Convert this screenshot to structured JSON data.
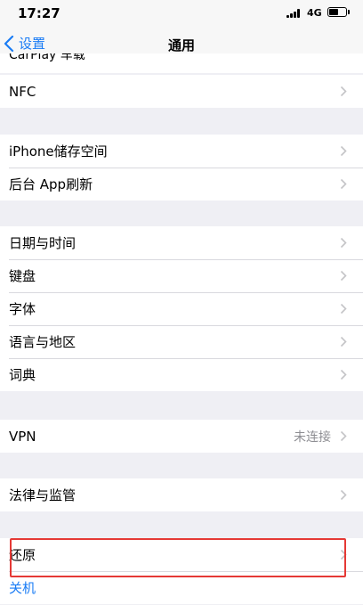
{
  "status_bar": {
    "time": "17:27",
    "network": "4G"
  },
  "nav": {
    "back_label": "设置",
    "title": "通用"
  },
  "partial_row": {
    "label": "CarPlay 车载"
  },
  "groups": [
    [
      {
        "label": "NFC"
      }
    ],
    [
      {
        "label": "iPhone储存空间"
      },
      {
        "label": "后台 App刷新"
      }
    ],
    [
      {
        "label": "日期与时间"
      },
      {
        "label": "键盘"
      },
      {
        "label": "字体"
      },
      {
        "label": "语言与地区"
      },
      {
        "label": "词典"
      }
    ],
    [
      {
        "label": "VPN",
        "value": "未连接"
      }
    ],
    [
      {
        "label": "法律与监管"
      }
    ],
    [
      {
        "label": "还原"
      },
      {
        "label": "关机"
      }
    ]
  ],
  "colors": {
    "accent": "#1a7cf5",
    "highlight": "#e53935",
    "background": "#efeff4"
  }
}
